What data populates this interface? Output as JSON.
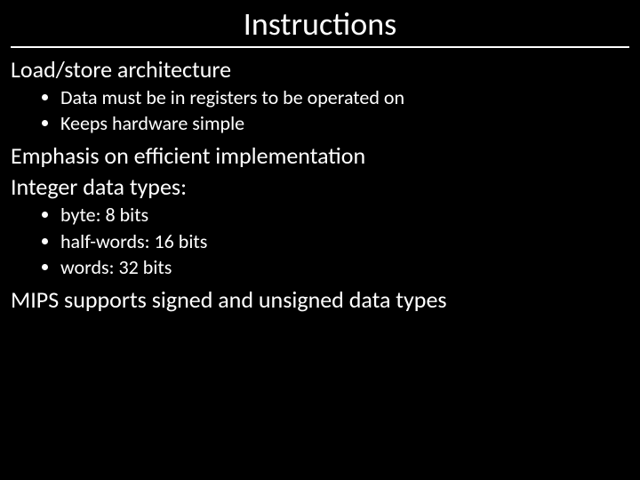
{
  "title": "Instructions",
  "body": {
    "p1": "Load/store architecture",
    "sub1": {
      "i1": "Data must be in registers to be operated on",
      "i2": "Keeps hardware simple"
    },
    "p2": "Emphasis on efficient implementation",
    "p3": "Integer data types:",
    "sub2": {
      "i1": "byte: 8 bits",
      "i2": "half-words: 16 bits",
      "i3": "words: 32 bits"
    },
    "p4": "MIPS supports signed and unsigned data types"
  }
}
